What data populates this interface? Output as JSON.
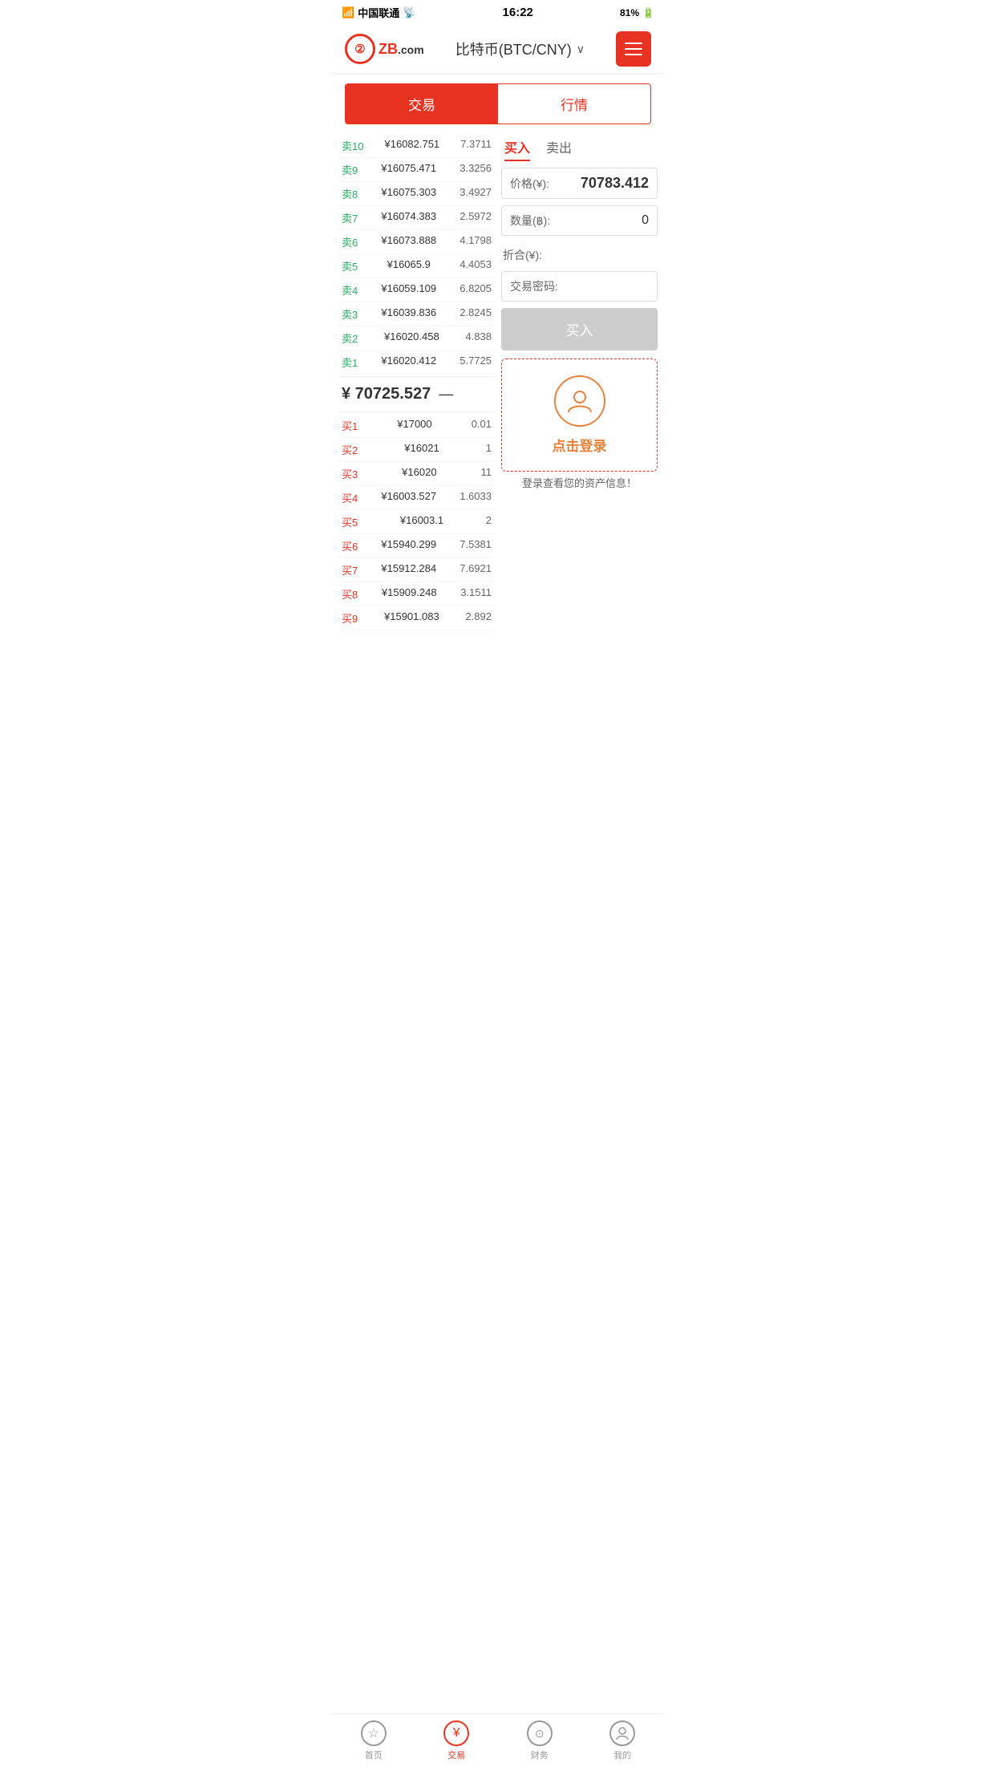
{
  "statusBar": {
    "carrier": "中国联通",
    "time": "16:22",
    "battery": "81%"
  },
  "header": {
    "logoText": "ZB",
    "logoDomain": ".com",
    "title": "比特币(BTC/CNY)",
    "chevron": "∨"
  },
  "tabs": {
    "trade": "交易",
    "market": "行情"
  },
  "buySellTabs": {
    "buy": "买入",
    "sell": "卖出"
  },
  "sellOrders": [
    {
      "label": "卖10",
      "price": "¥16082.751",
      "qty": "7.3711"
    },
    {
      "label": "卖9",
      "price": "¥16075.471",
      "qty": "3.3256"
    },
    {
      "label": "卖8",
      "price": "¥16075.303",
      "qty": "3.4927"
    },
    {
      "label": "卖7",
      "price": "¥16074.383",
      "qty": "2.5972"
    },
    {
      "label": "卖6",
      "price": "¥16073.888",
      "qty": "4.1798"
    },
    {
      "label": "卖5",
      "price": "¥16065.9",
      "qty": "4.4053"
    },
    {
      "label": "卖4",
      "price": "¥16059.109",
      "qty": "6.8205"
    },
    {
      "label": "卖3",
      "price": "¥16039.836",
      "qty": "2.8245"
    },
    {
      "label": "卖2",
      "price": "¥16020.458",
      "qty": "4.838"
    },
    {
      "label": "卖1",
      "price": "¥16020.412",
      "qty": "5.7725"
    }
  ],
  "currentPrice": {
    "value": "¥ 70725.527",
    "indicator": "—"
  },
  "buyOrders": [
    {
      "label": "买1",
      "price": "¥17000",
      "qty": "0.01"
    },
    {
      "label": "买2",
      "price": "¥16021",
      "qty": "1"
    },
    {
      "label": "买3",
      "price": "¥16020",
      "qty": "11"
    },
    {
      "label": "买4",
      "price": "¥16003.527",
      "qty": "1.6033"
    },
    {
      "label": "买5",
      "price": "¥16003.1",
      "qty": "2"
    },
    {
      "label": "买6",
      "price": "¥15940.299",
      "qty": "7.5381"
    },
    {
      "label": "买7",
      "price": "¥15912.284",
      "qty": "7.6921"
    },
    {
      "label": "买8",
      "price": "¥15909.248",
      "qty": "3.1511"
    },
    {
      "label": "买9",
      "price": "¥15901.083",
      "qty": "2.892"
    }
  ],
  "tradeForm": {
    "priceLabel": "价格(¥):",
    "priceValue": "70783.412",
    "qtyLabel": "数量(฿):",
    "qtyValue": "0",
    "zheheLabel": "折合(¥):",
    "passwordLabel": "交易密码:",
    "buyButton": "买入"
  },
  "loginBox": {
    "loginText": "点击登录",
    "assetInfo": "登录查看您的资产信息！"
  },
  "bottomNav": [
    {
      "id": "home",
      "label": "首页",
      "icon": "☆",
      "active": false
    },
    {
      "id": "trade",
      "label": "交易",
      "icon": "¥",
      "active": true
    },
    {
      "id": "finance",
      "label": "财务",
      "icon": "💰",
      "active": false
    },
    {
      "id": "profile",
      "label": "我的",
      "icon": "👤",
      "active": false
    }
  ]
}
